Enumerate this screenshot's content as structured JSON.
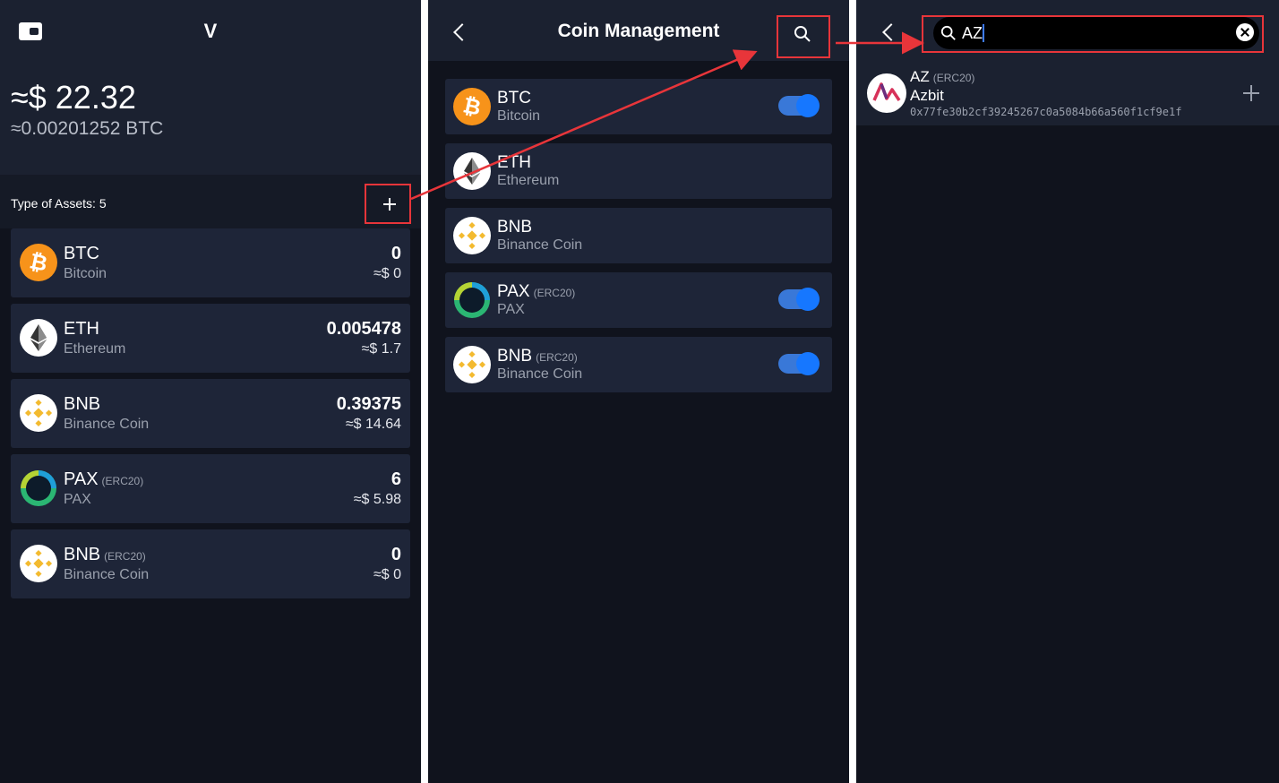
{
  "colors": {
    "accent_red": "#e8353a",
    "toggle_blue": "#1677ff",
    "panel_bg": "#10131d",
    "card_bg": "#1e2538"
  },
  "wallet": {
    "name": "V",
    "total_usd": "≈$ 22.32",
    "total_btc": "≈0.00201252 BTC",
    "types_label": "Type of Assets: 5",
    "assets": [
      {
        "symbol": "BTC",
        "tag": "",
        "name": "Bitcoin",
        "amount": "0",
        "value": "≈$ 0",
        "icon": "btc-icon"
      },
      {
        "symbol": "ETH",
        "tag": "",
        "name": "Ethereum",
        "amount": "0.005478",
        "value": "≈$ 1.7",
        "icon": "eth-icon"
      },
      {
        "symbol": "BNB",
        "tag": "",
        "name": "Binance Coin",
        "amount": "0.39375",
        "value": "≈$ 14.64",
        "icon": "bnb-icon"
      },
      {
        "symbol": "PAX",
        "tag": "(ERC20)",
        "name": "PAX",
        "amount": "6",
        "value": "≈$ 5.98",
        "icon": "pax-icon"
      },
      {
        "symbol": "BNB",
        "tag": "(ERC20)",
        "name": "Binance Coin",
        "amount": "0",
        "value": "≈$ 0",
        "icon": "bnb-icon"
      }
    ]
  },
  "coin_management": {
    "title": "Coin Management",
    "coins": [
      {
        "symbol": "BTC",
        "tag": "",
        "name": "Bitcoin",
        "enabled": true,
        "icon": "btc-icon"
      },
      {
        "symbol": "ETH",
        "tag": "",
        "name": "Ethereum",
        "enabled": false,
        "icon": "eth-icon"
      },
      {
        "symbol": "BNB",
        "tag": "",
        "name": "Binance Coin",
        "enabled": false,
        "icon": "bnb-icon"
      },
      {
        "symbol": "PAX",
        "tag": "(ERC20)",
        "name": "PAX",
        "enabled": true,
        "icon": "pax-icon"
      },
      {
        "symbol": "BNB",
        "tag": "(ERC20)",
        "name": "Binance Coin",
        "enabled": true,
        "icon": "bnb-icon"
      }
    ]
  },
  "search": {
    "query": "AZ",
    "results": [
      {
        "symbol": "AZ",
        "tag": "(ERC20)",
        "name": "Azbit",
        "address": "0x77fe30b2cf39245267c0a5084b66a560f1cf9e1f",
        "icon": "azbit-icon"
      }
    ]
  }
}
